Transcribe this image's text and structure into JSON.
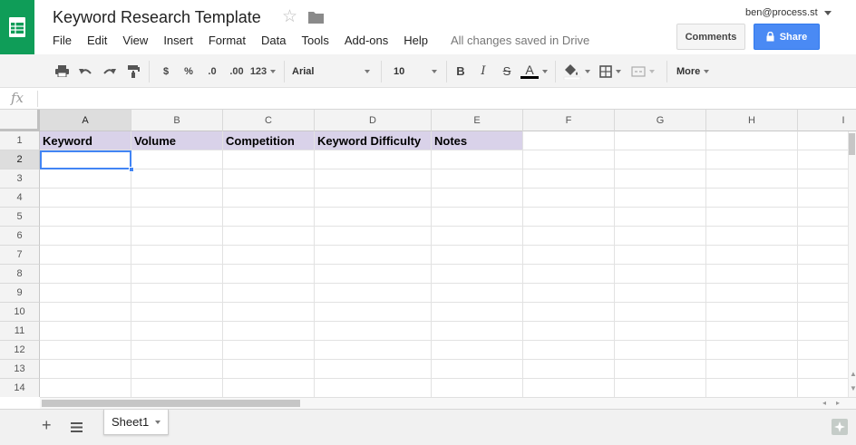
{
  "header": {
    "title": "Keyword Research Template",
    "menu": [
      "File",
      "Edit",
      "View",
      "Insert",
      "Format",
      "Data",
      "Tools",
      "Add-ons",
      "Help"
    ],
    "save_status": "All changes saved in Drive",
    "user_email": "ben@process.st",
    "comments_label": "Comments",
    "share_label": "Share",
    "brand_color": "#0f9d58",
    "share_color": "#4a8af4"
  },
  "toolbar": {
    "currency": "$",
    "percent": "%",
    "decrease_decimal": ".0",
    "increase_decimal": ".00",
    "more_formats": "123",
    "font": "Arial",
    "font_size": "10",
    "bold": "B",
    "italic": "I",
    "strikethrough": "S",
    "text_color": "A",
    "more": "More"
  },
  "formula_bar": {
    "fx_label": "fx",
    "value": ""
  },
  "grid": {
    "columns": [
      "A",
      "B",
      "C",
      "D",
      "E",
      "F",
      "G",
      "H",
      "I"
    ],
    "rows": [
      "1",
      "2",
      "3",
      "4",
      "5",
      "6",
      "7",
      "8",
      "9",
      "10",
      "11",
      "12",
      "13",
      "14"
    ],
    "header_row": [
      "Keyword",
      "Volume",
      "Competition",
      "Keyword Difficulty",
      "Notes"
    ],
    "header_fill": "#d9d2e9",
    "active_cell": "A2"
  },
  "sheets": {
    "tabs": [
      "Sheet1"
    ],
    "active": "Sheet1"
  }
}
